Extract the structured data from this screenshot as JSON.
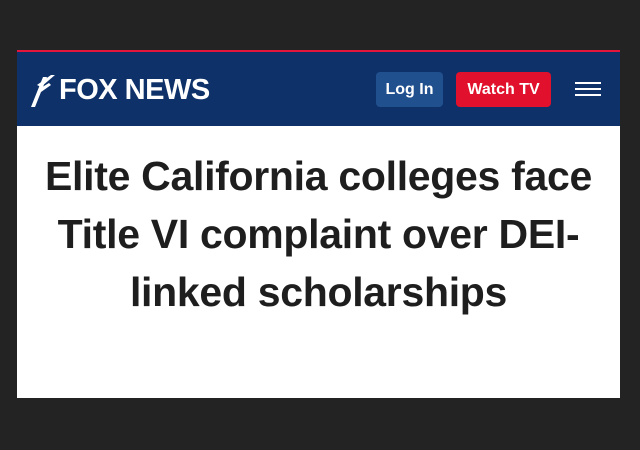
{
  "header": {
    "brand": {
      "logo_text": "FOX NEWS",
      "logo_icon": "fox-news-logo-icon"
    },
    "login_label": "Log In",
    "watch_tv_label": "Watch TV",
    "menu_icon": "hamburger-menu-icon"
  },
  "article": {
    "headline": "Elite California colleges face Title VI complaint over DEI-linked scholarships"
  },
  "colors": {
    "header_bg": "#0d3168",
    "accent_red": "#e1102c",
    "login_button_bg": "#21508f",
    "page_bg": "#232323",
    "card_bg": "#ffffff",
    "headline_text": "#1e1e1e"
  }
}
